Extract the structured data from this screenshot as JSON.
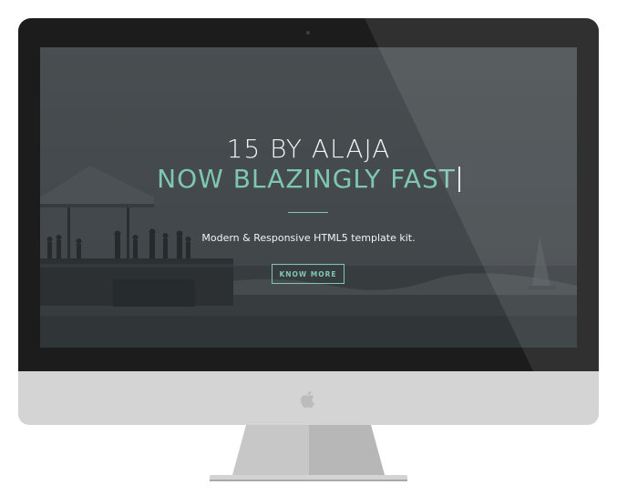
{
  "hero": {
    "title": "15 BY ALAJA",
    "subtitle": "NOW BLAZINGLY FAST",
    "tagline": "Modern & Responsive HTML5 template kit.",
    "cta_label": "KNOW MORE"
  },
  "colors": {
    "accent": "#7fc7ae",
    "bezel": "#1c1c1c",
    "chin": "#d4d4d4",
    "overlay": "#4a4f52"
  },
  "icons": {
    "brand_logo": "apple-logo-icon",
    "camera": "camera-icon"
  }
}
